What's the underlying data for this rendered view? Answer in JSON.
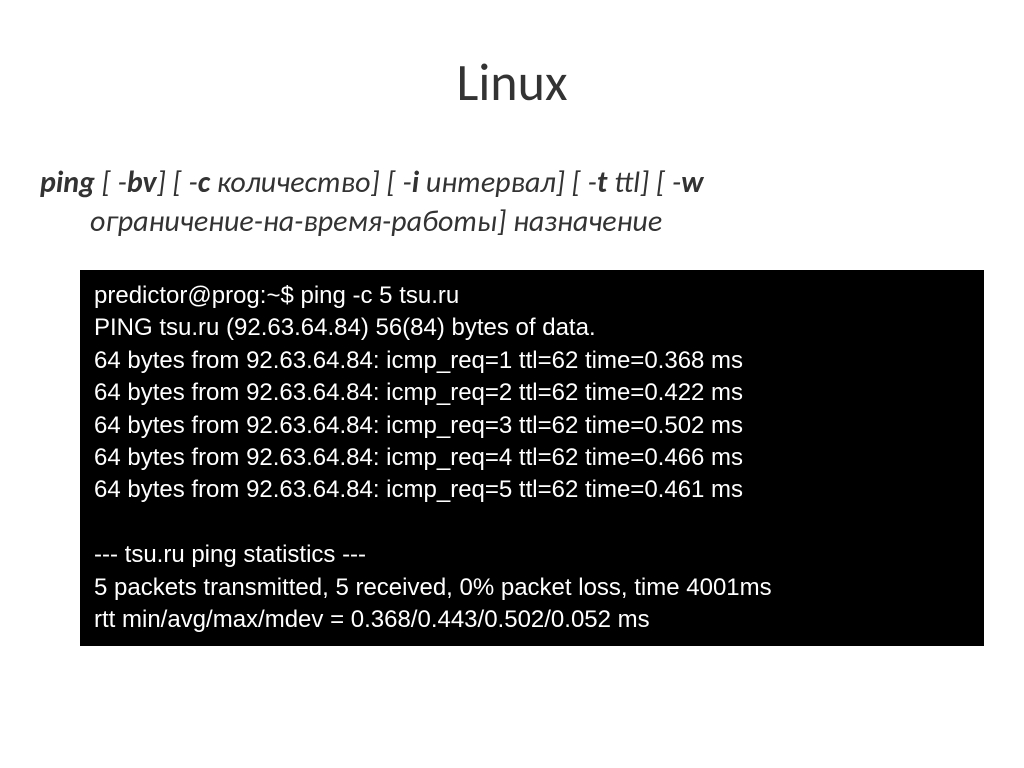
{
  "title": "Linux",
  "syntax": {
    "cmd": "ping",
    "opt_bv": "bv",
    "opt_c": "c",
    "opt_c_arg": "количество",
    "opt_i": "i",
    "opt_i_arg": "интервал",
    "opt_t": "t",
    "opt_t_arg": "ttl",
    "opt_w": "w",
    "opt_w_arg": "ограничение-на-время-работы",
    "dest": "назначение"
  },
  "terminal": {
    "lines": [
      "predictor@prog:~$ ping -c 5 tsu.ru",
      "PING tsu.ru (92.63.64.84) 56(84) bytes of data.",
      "64 bytes from 92.63.64.84: icmp_req=1 ttl=62 time=0.368 ms",
      "64 bytes from 92.63.64.84: icmp_req=2 ttl=62 time=0.422 ms",
      "64 bytes from 92.63.64.84: icmp_req=3 ttl=62 time=0.502 ms",
      "64 bytes from 92.63.64.84: icmp_req=4 ttl=62 time=0.466 ms",
      "64 bytes from 92.63.64.84: icmp_req=5 ttl=62 time=0.461 ms",
      "",
      "--- tsu.ru ping statistics ---",
      "5 packets transmitted, 5 received, 0% packet loss, time 4001ms",
      "rtt min/avg/max/mdev = 0.368/0.443/0.502/0.052 ms"
    ]
  }
}
